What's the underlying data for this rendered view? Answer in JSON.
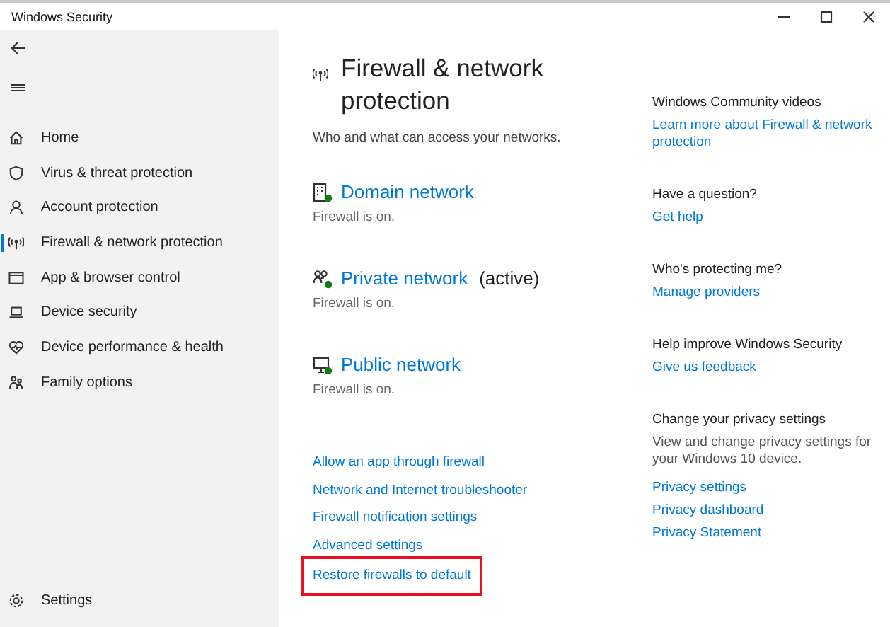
{
  "window": {
    "title": "Windows Security",
    "controls": [
      {
        "kind": "minimize"
      },
      {
        "kind": "maximize"
      },
      {
        "kind": "close"
      }
    ]
  },
  "sidebar": {
    "items": [
      {
        "label": "Home",
        "kind": "home",
        "selected": false
      },
      {
        "label": "Virus & threat protection",
        "kind": "virus",
        "selected": false
      },
      {
        "label": "Account protection",
        "kind": "account",
        "selected": false
      },
      {
        "label": "Firewall & network protection",
        "kind": "firewall",
        "selected": true
      },
      {
        "label": "App & browser control",
        "kind": "app",
        "selected": false
      },
      {
        "label": "Device security",
        "kind": "device",
        "selected": false
      },
      {
        "label": "Device performance & health",
        "kind": "health",
        "selected": false
      },
      {
        "label": "Family options",
        "kind": "family",
        "selected": false
      }
    ],
    "settings": {
      "label": "Settings"
    }
  },
  "main": {
    "title": "Firewall & network protection",
    "subtitle": "Who and what can access your networks.",
    "networks": [
      {
        "name": "Domain network",
        "kind": "domain",
        "status": "Firewall is on."
      },
      {
        "name": "Private network",
        "kind": "private",
        "active_label": "(active)",
        "status": "Firewall is on."
      },
      {
        "name": "Public network",
        "kind": "public",
        "status": "Firewall is on."
      }
    ],
    "links": [
      {
        "label": "Allow an app through firewall",
        "highlighted": false
      },
      {
        "label": "Network and Internet troubleshooter",
        "highlighted": false
      },
      {
        "label": "Firewall notification settings",
        "highlighted": false
      },
      {
        "label": "Advanced settings",
        "highlighted": false
      },
      {
        "label": "Restore firewalls to default",
        "highlighted": true
      }
    ]
  },
  "aside": {
    "sections": [
      {
        "heading": "Windows Community videos",
        "links": [
          "Learn more about Firewall & network protection"
        ]
      },
      {
        "heading": "Have a question?",
        "links": [
          "Get help"
        ]
      },
      {
        "heading": "Who's protecting me?",
        "links": [
          "Manage providers"
        ]
      },
      {
        "heading": "Help improve Windows Security",
        "links": [
          "Give us feedback"
        ]
      },
      {
        "heading": "Change your privacy settings",
        "text": "View and change privacy settings for your Windows 10 device.",
        "links": [
          "Privacy settings",
          "Privacy dashboard",
          "Privacy Statement"
        ]
      }
    ]
  }
}
